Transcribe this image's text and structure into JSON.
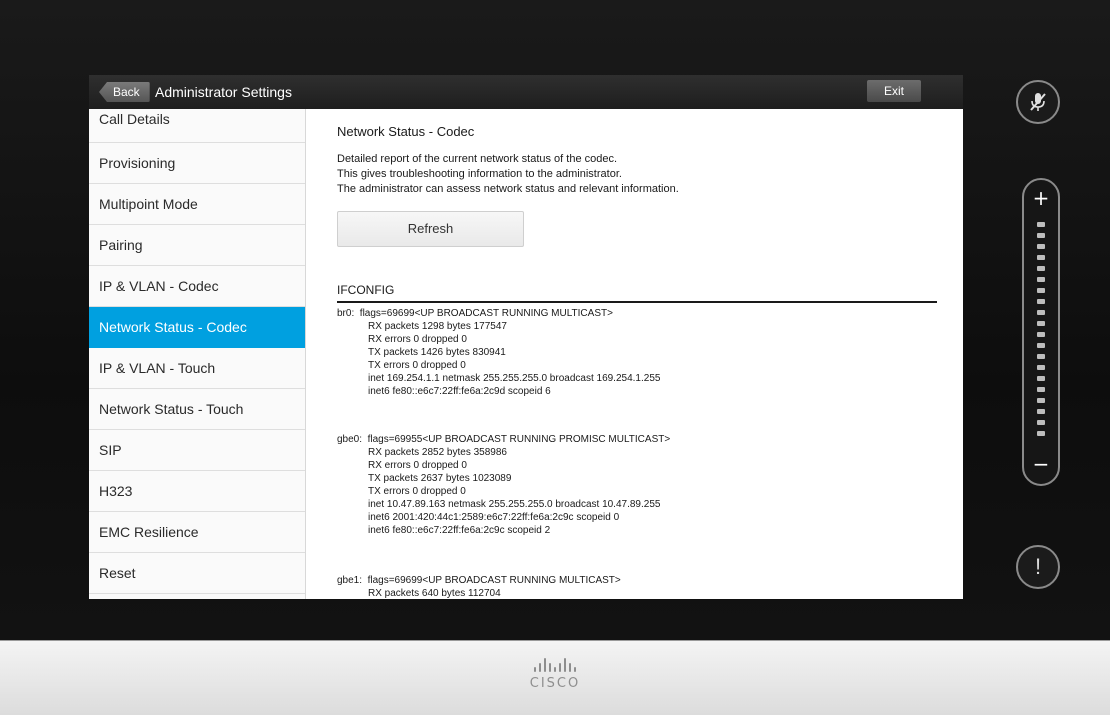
{
  "titlebar": {
    "back_label": "Back",
    "title": "Administrator Settings",
    "exit_label": "Exit"
  },
  "sidebar": {
    "items": [
      {
        "label": "Call Details",
        "active": false
      },
      {
        "label": "Provisioning",
        "active": false
      },
      {
        "label": "Multipoint Mode",
        "active": false
      },
      {
        "label": "Pairing",
        "active": false
      },
      {
        "label": "IP & VLAN - Codec",
        "active": false
      },
      {
        "label": "Network Status - Codec",
        "active": true
      },
      {
        "label": "IP & VLAN - Touch",
        "active": false
      },
      {
        "label": "Network Status - Touch",
        "active": false
      },
      {
        "label": "SIP",
        "active": false
      },
      {
        "label": "H323",
        "active": false
      },
      {
        "label": "EMC Resilience",
        "active": false
      },
      {
        "label": "Reset",
        "active": false
      }
    ]
  },
  "content": {
    "title": "Network Status - Codec",
    "description": [
      "Detailed report of the current network status of the codec.",
      "This gives troubleshooting information to the administrator.",
      "The administrator can assess network status and relevant information."
    ],
    "refresh_label": "Refresh",
    "section_title": "IFCONFIG",
    "interfaces": [
      {
        "name": "br0:",
        "flags": "flags=69699<UP BROADCAST RUNNING MULTICAST>",
        "lines": [
          "RX packets 1298 bytes 177547",
          "RX errors 0 dropped 0",
          "TX packets 1426 bytes 830941",
          "TX errors 0 dropped 0",
          "inet 169.254.1.1 netmask 255.255.255.0 broadcast 169.254.1.255",
          "inet6 fe80::e6c7:22ff:fe6a:2c9d scopeid 6"
        ]
      },
      {
        "name": "gbe0:",
        "flags": "flags=69955<UP BROADCAST RUNNING PROMISC MULTICAST>",
        "lines": [
          "RX packets 2852 bytes 358986",
          "RX errors 0 dropped 0",
          "TX packets 2637 bytes 1023089",
          "TX errors 0 dropped 0",
          "inet 10.47.89.163 netmask 255.255.255.0 broadcast 10.47.89.255",
          "inet6 2001:420:44c1:2589:e6c7:22ff:fe6a:2c9c scopeid 0",
          "inet6 fe80::e6c7:22ff:fe6a:2c9c scopeid 2"
        ]
      },
      {
        "name": "gbe1:",
        "flags": "flags=69699<UP BROADCAST RUNNING MULTICAST>",
        "lines": [
          "RX packets 640 bytes 112704"
        ]
      }
    ]
  },
  "controls": {
    "mute_icon": "microphone-muted-icon",
    "volume_plus": "+",
    "volume_minus": "−",
    "alert_glyph": "!"
  },
  "brand": {
    "logo_text": "CISCO"
  },
  "colors": {
    "accent": "#00a0e0",
    "titlebar": "#222222"
  }
}
